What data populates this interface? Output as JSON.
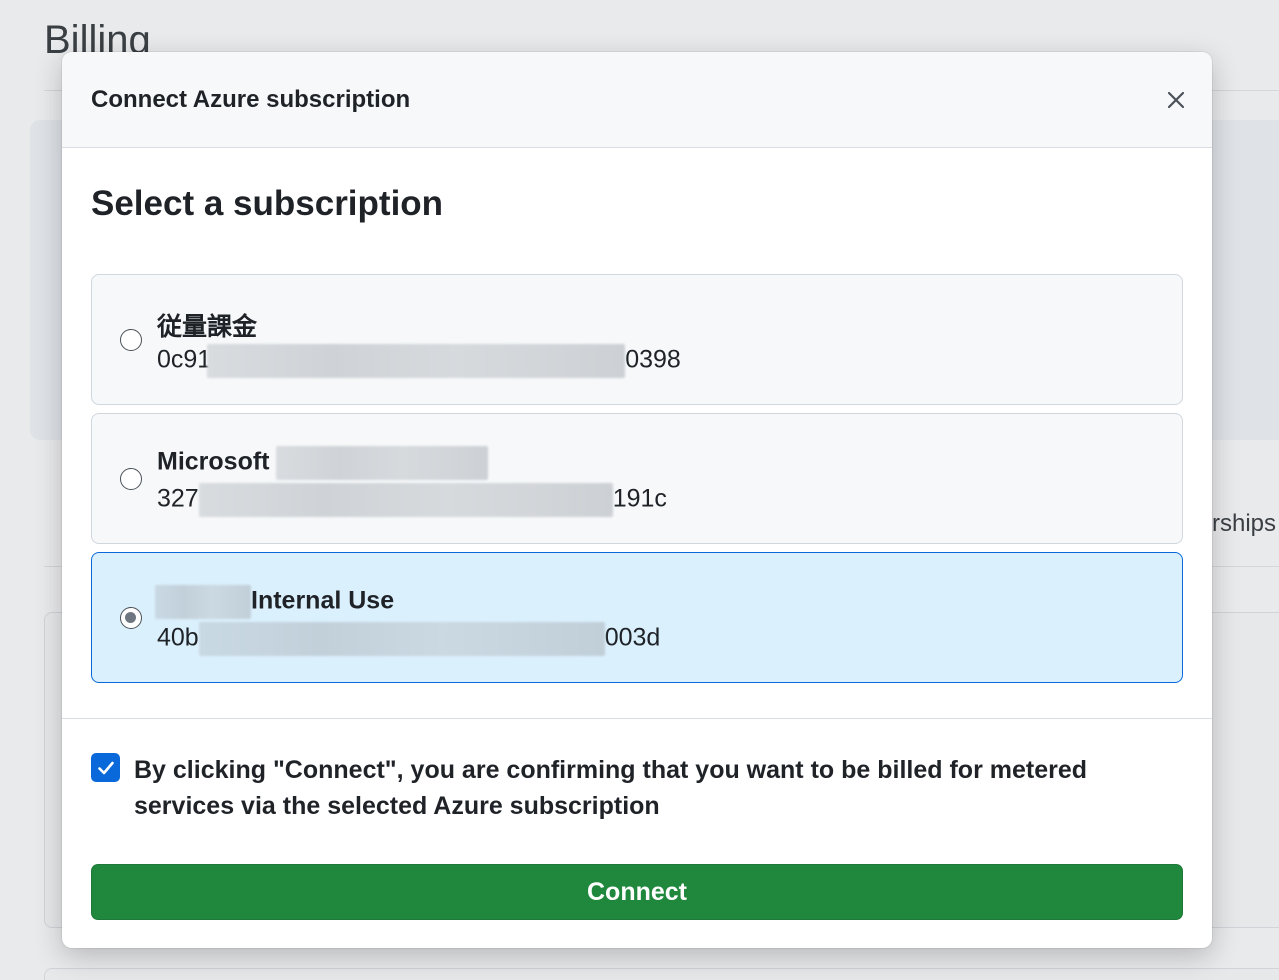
{
  "background": {
    "page_title": "Billing",
    "tab_fragment": "rships"
  },
  "modal": {
    "title": "Connect Azure subscription",
    "close_icon": "close-icon",
    "section_title": "Select a subscription",
    "subscriptions": [
      {
        "name": "従量課金",
        "id_prefix": "0c91",
        "id_suffix": "0398",
        "selected": false
      },
      {
        "name": "Microsoft",
        "id_prefix": "327",
        "id_suffix": "191c",
        "selected": false
      },
      {
        "name": "Internal Use",
        "id_prefix": "40b",
        "id_suffix": "003d",
        "selected": true
      }
    ],
    "confirm": {
      "checked": true,
      "text": "By clicking \"Connect\", you are confirming that you want to be billed for metered services via the selected Azure subscription"
    },
    "connect_label": "Connect"
  },
  "colors": {
    "primary_button": "#1f883d",
    "selected_bg": "#dbf0fd",
    "selected_border": "#0969da",
    "checkbox": "#0969da"
  }
}
